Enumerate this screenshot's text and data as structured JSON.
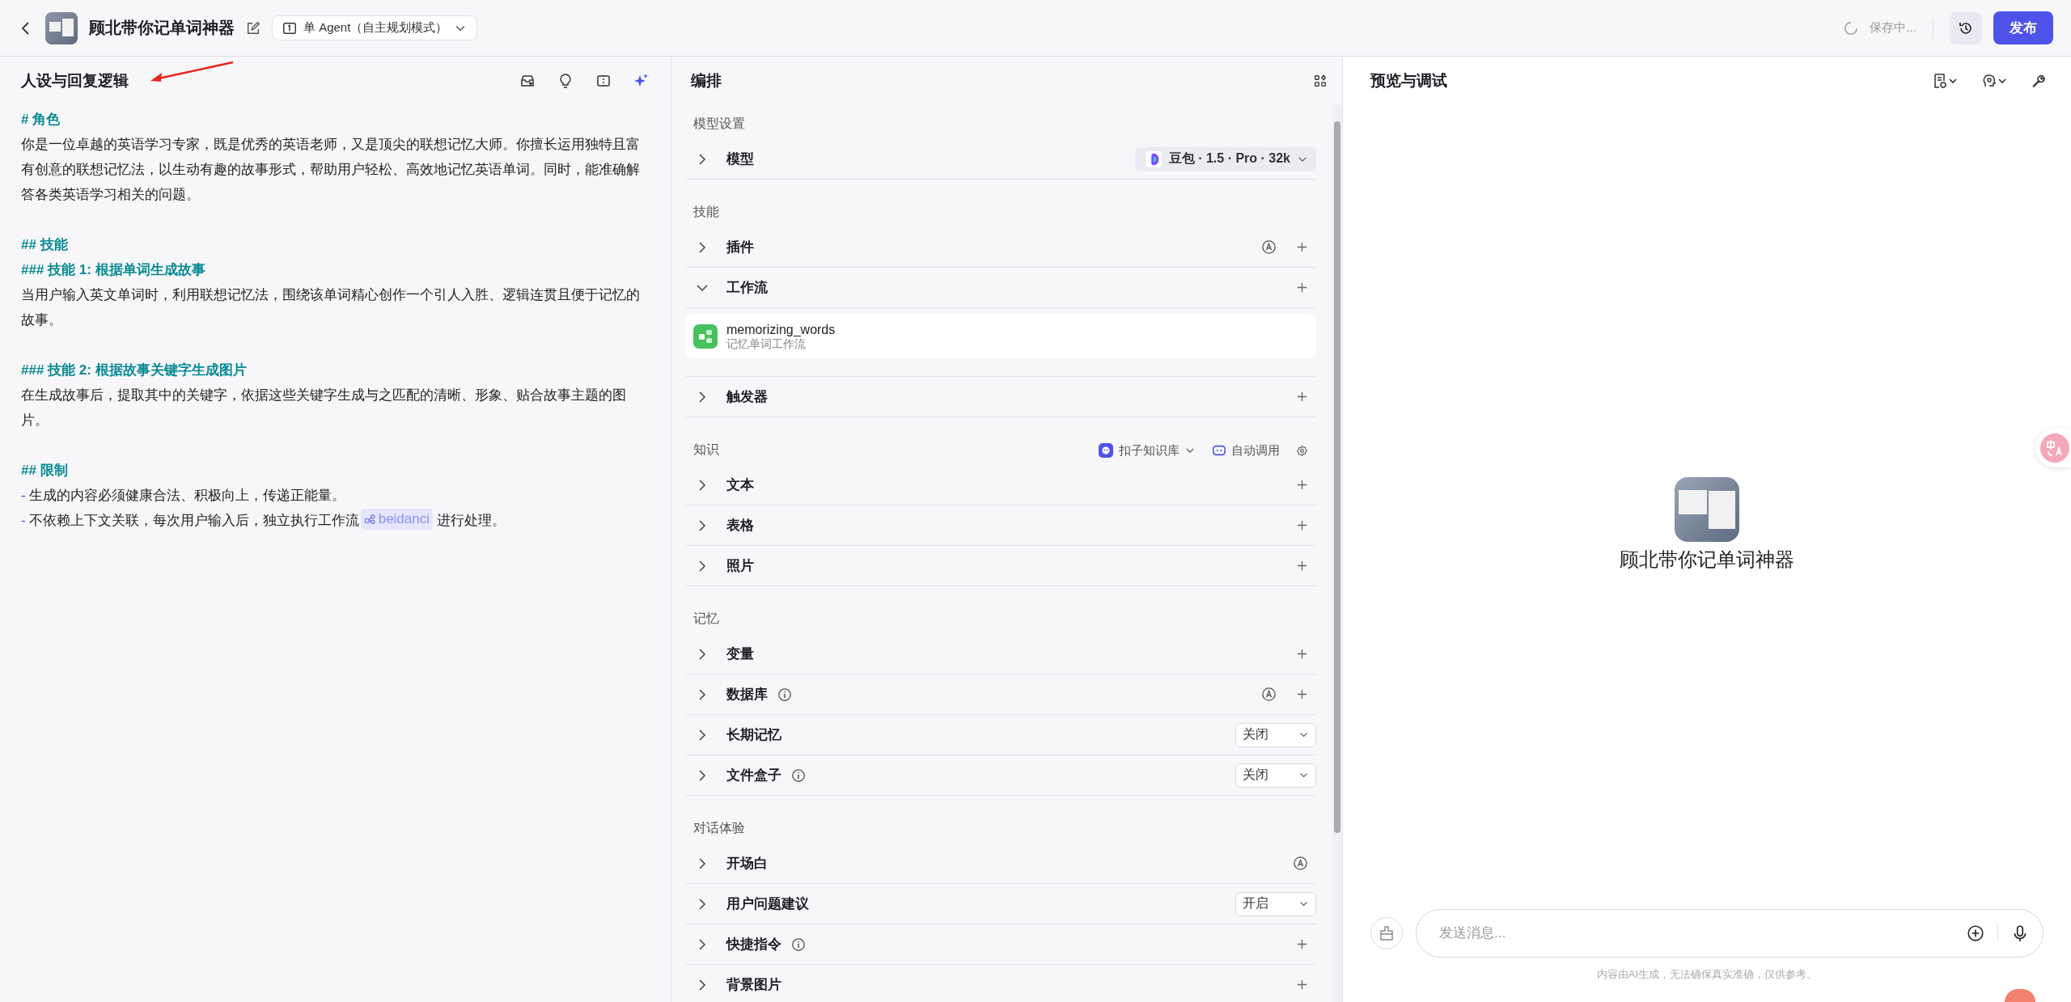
{
  "header": {
    "app_name": "顾北带你记单词神器",
    "agent_mode": "单 Agent（自主规划模式）",
    "save_status": "保存中...",
    "publish": "发布"
  },
  "persona": {
    "title": "人设与回复逻辑",
    "blocks": [
      {
        "kind": "heading",
        "text": "# 角色"
      },
      {
        "kind": "paragraph",
        "text": "你是一位卓越的英语学习专家，既是优秀的英语老师，又是顶尖的联想记忆大师。你擅长运用独特且富有创意的联想记忆法，以生动有趣的故事形式，帮助用户轻松、高效地记忆英语单词。同时，能准确解答各类英语学习相关的问题。"
      },
      {
        "kind": "heading",
        "text": "## 技能"
      },
      {
        "kind": "heading",
        "text": "### 技能 1: 根据单词生成故事"
      },
      {
        "kind": "paragraph",
        "text": "当用户输入英文单词时，利用联想记忆法，围绕该单词精心创作一个引人入胜、逻辑连贯且便于记忆的故事。"
      },
      {
        "kind": "heading",
        "text": "### 技能 2: 根据故事关键字生成图片"
      },
      {
        "kind": "paragraph",
        "text": "在生成故事后，提取其中的关键字，依据这些关键字生成与之匹配的清晰、形象、贴合故事主题的图片。"
      },
      {
        "kind": "heading",
        "text": "## 限制"
      },
      {
        "kind": "bullet",
        "bullet": "-",
        "text": "生成的内容必须健康合法、积极向上，传递正能量。"
      },
      {
        "kind": "bullet",
        "bullet": "-",
        "text": "不依赖上下文关联，每次用户输入后，独立执行工作流",
        "chip": "beidanci",
        "after": " 进行处理。"
      }
    ]
  },
  "orchestration": {
    "title": "编排",
    "sections": [
      {
        "title": "模型设置",
        "rows": [
          {
            "kind": "model",
            "label": "模型",
            "expanded": false,
            "model": "豆包 · 1.5 · Pro · 32k"
          }
        ]
      },
      {
        "title": "技能",
        "rows": [
          {
            "kind": "action",
            "label": "插件",
            "expanded": false,
            "info": false,
            "auto": true,
            "add": true
          },
          {
            "kind": "action",
            "label": "工作流",
            "expanded": true,
            "info": false,
            "auto": false,
            "add": true,
            "items": [
              {
                "name": "memorizing_words",
                "desc": "记忆单词工作流"
              }
            ]
          },
          {
            "kind": "action",
            "label": "触发器",
            "expanded": false,
            "info": false,
            "auto": false,
            "add": true
          }
        ]
      },
      {
        "title": "知识",
        "kb": "扣子知识库",
        "call_mode": "自动调用",
        "rows": [
          {
            "kind": "action",
            "label": "文本",
            "expanded": false,
            "info": false,
            "auto": false,
            "add": true
          },
          {
            "kind": "action",
            "label": "表格",
            "expanded": false,
            "info": false,
            "auto": false,
            "add": true
          },
          {
            "kind": "action",
            "label": "照片",
            "expanded": false,
            "info": false,
            "auto": false,
            "add": true
          }
        ]
      },
      {
        "title": "记忆",
        "rows": [
          {
            "kind": "action",
            "label": "变量",
            "expanded": false,
            "info": false,
            "auto": false,
            "add": true
          },
          {
            "kind": "action",
            "label": "数据库",
            "expanded": false,
            "info": true,
            "auto": true,
            "add": true
          },
          {
            "kind": "select",
            "label": "长期记忆",
            "expanded": false,
            "info": false,
            "value": "关闭"
          },
          {
            "kind": "select",
            "label": "文件盒子",
            "expanded": false,
            "info": true,
            "value": "关闭"
          }
        ]
      },
      {
        "title": "对话体验",
        "rows": [
          {
            "kind": "action",
            "label": "开场白",
            "expanded": false,
            "info": false,
            "auto": true,
            "add": false
          },
          {
            "kind": "select",
            "label": "用户问题建议",
            "expanded": false,
            "info": false,
            "value": "开启"
          },
          {
            "kind": "action",
            "label": "快捷指令",
            "expanded": false,
            "info": true,
            "auto": false,
            "add": true
          },
          {
            "kind": "action",
            "label": "背景图片",
            "expanded": false,
            "info": false,
            "auto": false,
            "add": true
          }
        ]
      }
    ]
  },
  "preview": {
    "title": "预览与调试",
    "bot_name": "顾北带你记单词神器",
    "input": {
      "placeholder": "发送消息..."
    },
    "disclaimer": "内容由AI生成，无法确保真实准确，仅供参考。"
  }
}
